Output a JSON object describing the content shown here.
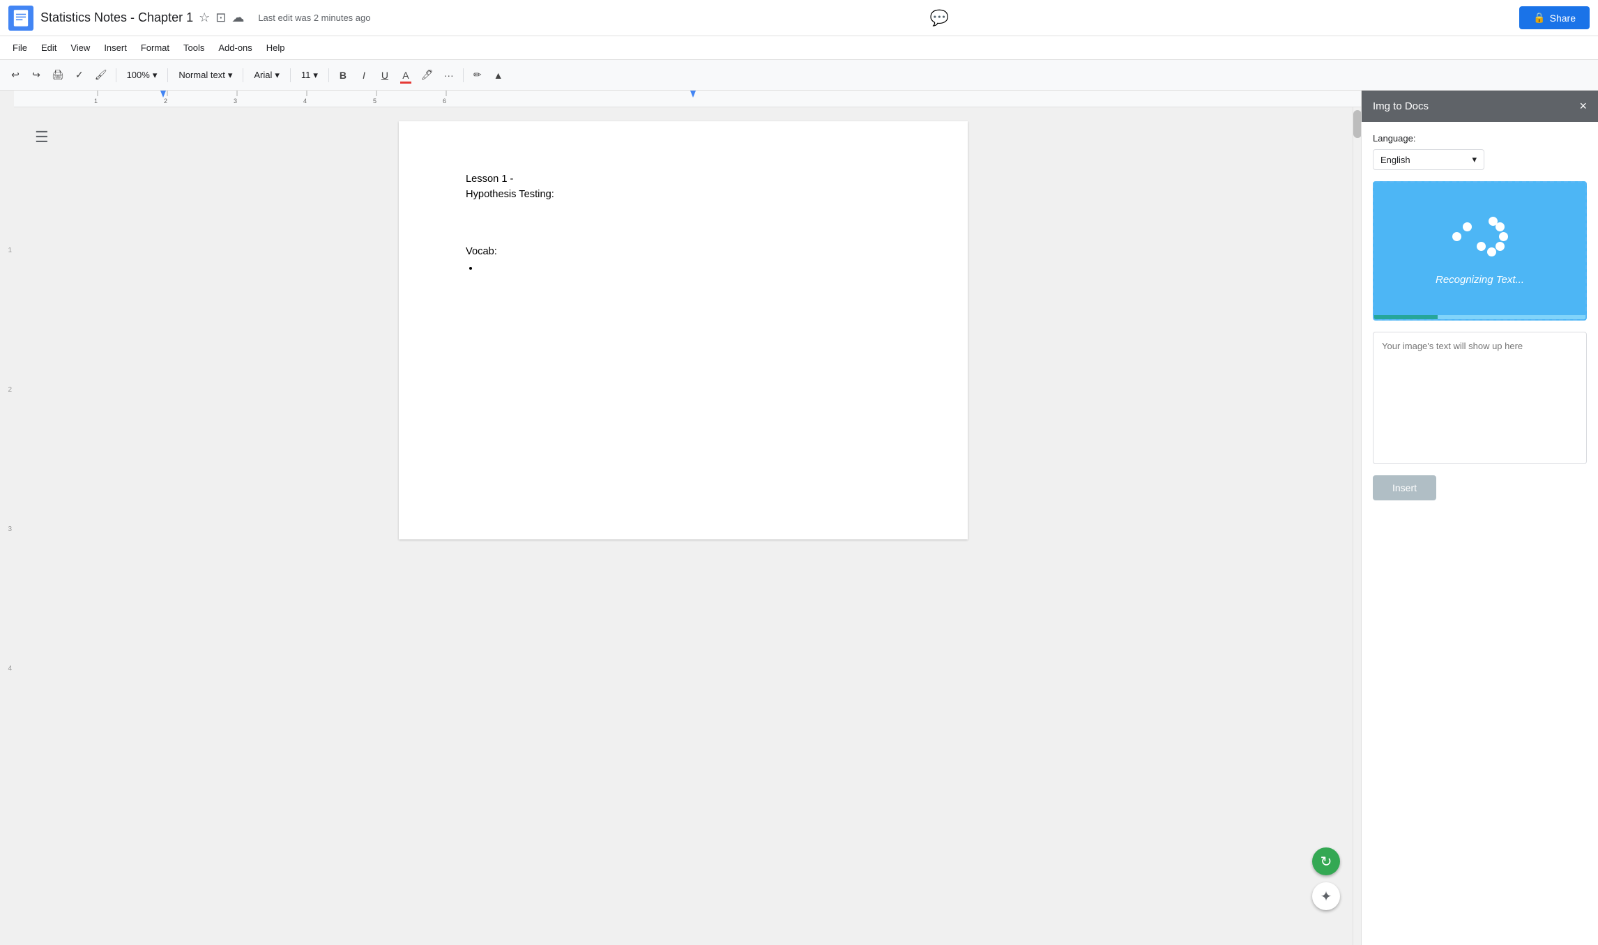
{
  "app": {
    "title": "Statistics Notes - Chapter 1",
    "last_edit": "Last edit was 2 minutes ago"
  },
  "menu": {
    "items": [
      "File",
      "Edit",
      "View",
      "Insert",
      "Format",
      "Tools",
      "Add-ons",
      "Help"
    ]
  },
  "toolbar": {
    "zoom": "100%",
    "text_style": "Normal text",
    "font": "Arial",
    "font_size": "11",
    "bold": "B",
    "italic": "I",
    "underline": "U"
  },
  "document": {
    "content": [
      {
        "type": "text",
        "value": "Lesson 1 -"
      },
      {
        "type": "text",
        "value": "Hypothesis Testing:"
      },
      {
        "type": "text",
        "value": "Vocab:"
      }
    ]
  },
  "panel": {
    "title": "Img to Docs",
    "close_label": "×",
    "language_label": "Language:",
    "language_value": "English",
    "recognizing_text": "Recognizing Text...",
    "placeholder_text": "Your image's text will show up here",
    "insert_button": "Insert"
  },
  "share_button": "Share"
}
